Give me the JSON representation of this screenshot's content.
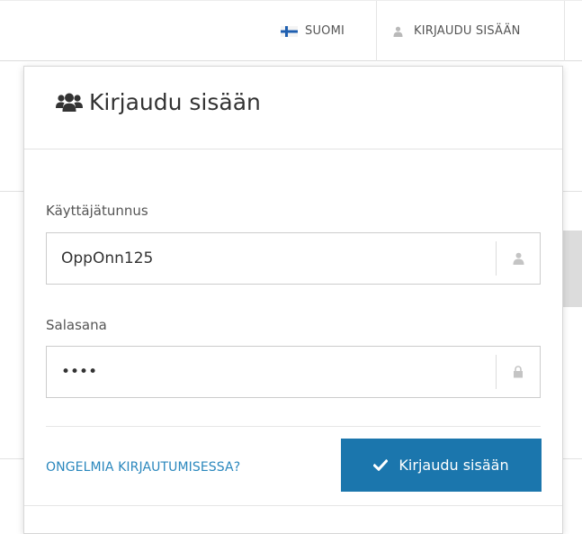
{
  "topbar": {
    "language_label": "SUOMI",
    "language_icon": "finnish-flag-icon",
    "login_label": "KIRJAUDU SISÄÄN",
    "login_icon": "user-icon"
  },
  "login_panel": {
    "title": "Kirjaudu sisään",
    "title_icon": "users-group-icon",
    "username": {
      "label": "Käyttäjätunnus",
      "value": "OppOnn125",
      "icon": "user-icon"
    },
    "password": {
      "label": "Salasana",
      "value": "••••",
      "icon": "lock-icon"
    },
    "forgot_link": "ONGELMIA KIRJAUTUMISESSA?",
    "submit_label": "Kirjaudu sisään",
    "submit_icon": "check-icon"
  },
  "colors": {
    "accent": "#1b76ad",
    "link": "#2a87bd",
    "flag_blue": "#1f5fb0"
  }
}
